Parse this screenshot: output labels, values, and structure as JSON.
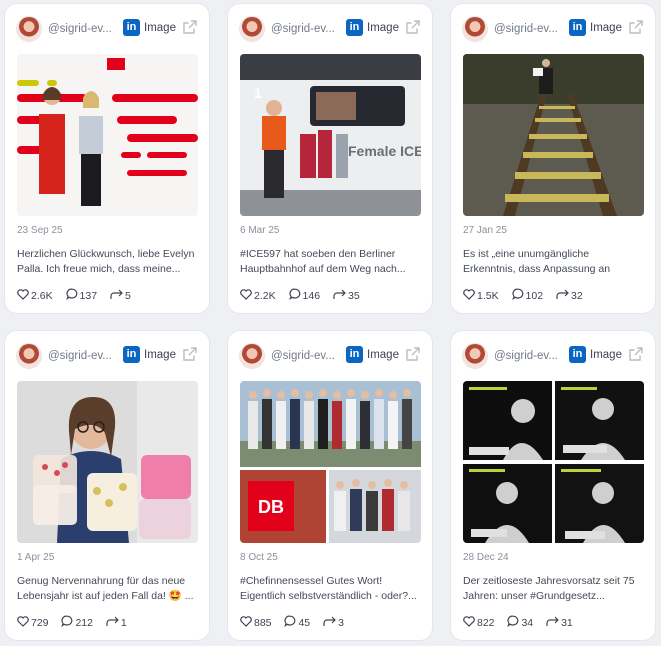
{
  "posts": [
    {
      "handle": "@sigrid-ev...",
      "network": "in",
      "type": "Image",
      "date": "23 Sep 25",
      "text": "Herzlichen Glückwunsch, liebe Evelyn Palla. Ich freue mich, dass meine...",
      "likes": "2.6K",
      "comments": "137",
      "shares": "5"
    },
    {
      "handle": "@sigrid-ev...",
      "network": "in",
      "type": "Image",
      "date": "6 Mar 25",
      "text": "#ICE597 hat soeben den Berliner Hauptbahnhof auf dem Weg nach...",
      "likes": "2.2K",
      "comments": "146",
      "shares": "35",
      "image_text": "Female ICE"
    },
    {
      "handle": "@sigrid-ev...",
      "network": "in",
      "type": "Image",
      "date": "27 Jan 25",
      "text": "Es ist „eine unumgängliche Erkenntnis, dass Anpassung an einen...",
      "likes": "1.5K",
      "comments": "102",
      "shares": "32"
    },
    {
      "handle": "@sigrid-ev...",
      "network": "in",
      "type": "Image",
      "date": "1 Apr 25",
      "text": "Genug Nervennahrung für das neue Lebensjahr ist auf jeden Fall da! 🤩 ...",
      "likes": "729",
      "comments": "212",
      "shares": "1"
    },
    {
      "handle": "@sigrid-ev...",
      "network": "in",
      "type": "Image",
      "date": "8 Oct 25",
      "text": "#Chefinnensessel Gutes Wort! Eigentlich selbstverständlich - oder?...",
      "likes": "885",
      "comments": "45",
      "shares": "3"
    },
    {
      "handle": "@sigrid-ev...",
      "network": "in",
      "type": "Image",
      "date": "28 Dec 24",
      "text": "Der zeitloseste Jahresvorsatz seit 75 Jahren: unser #Grundgesetz...",
      "likes": "822",
      "comments": "34",
      "shares": "31"
    }
  ],
  "icons": {
    "like": "heart-icon",
    "comment": "comment-bubble-icon",
    "share": "share-icon",
    "external": "external-link-icon",
    "network": "linkedin-icon"
  },
  "colors": {
    "linkedin": "#0a66c2",
    "db_red": "#e3001b"
  }
}
